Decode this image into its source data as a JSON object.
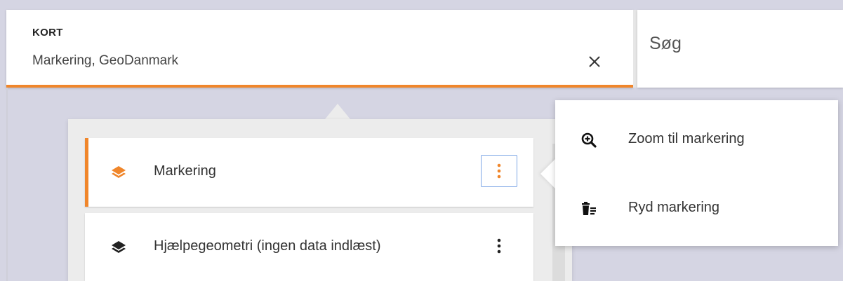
{
  "kort": {
    "title": "KORT",
    "subtitle": "Markering, GeoDanmark",
    "close_icon": "close-icon"
  },
  "search": {
    "placeholder": "Søg"
  },
  "layers": [
    {
      "label": "Markering",
      "icon": "layers-icon",
      "active": true,
      "icon_color": "#f0862b"
    },
    {
      "label": "Hjælpegeometri (ingen data indlæst)",
      "icon": "layers-icon",
      "active": false,
      "icon_color": "#222222"
    }
  ],
  "context_menu": {
    "items": [
      {
        "label": "Zoom til markering",
        "icon": "zoom-in-icon"
      },
      {
        "label": "Ryd markering",
        "icon": "clear-list-icon"
      }
    ]
  },
  "colors": {
    "accent": "#f0862b",
    "focus": "#7ea7e6",
    "background": "#d5d5e3"
  }
}
